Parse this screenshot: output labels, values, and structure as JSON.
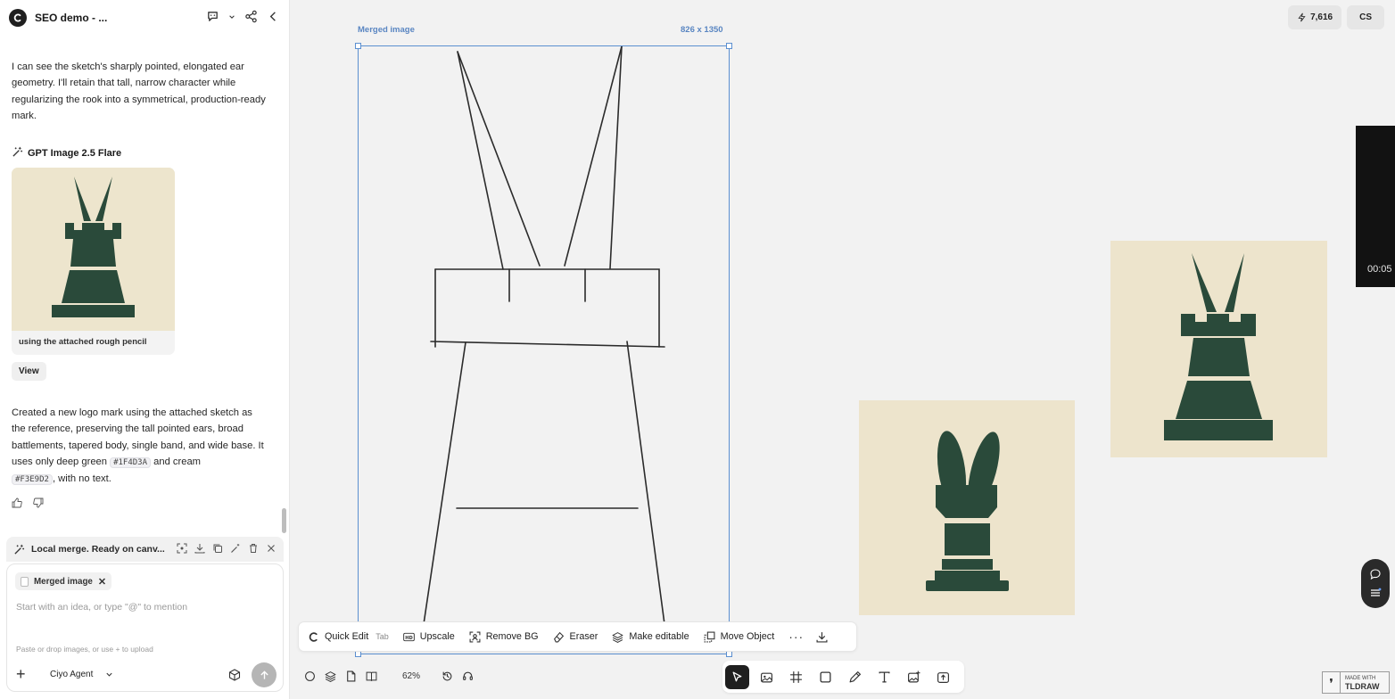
{
  "project": {
    "title": "SEO demo - ..."
  },
  "chat": {
    "message1": "I can see the sketch's sharply pointed, elongated ear geometry. I'll retain that tall, narrow character while regularizing the rook into a symmetrical, production-ready mark.",
    "model_name": "GPT Image 2.5 Flare",
    "thumb_caption": "using the attached rough pencil",
    "view_label": "View",
    "message2_a": "Created a new logo mark using the attached sketch as the reference, preserving the tall pointed ears, broad battlements, tapered body, single band, and wide base. It uses only deep green",
    "color1": "#1F4D3A",
    "message2_b": "and cream",
    "color2": "#F3E9D2",
    "message2_c": ", with no text."
  },
  "merge_status": {
    "label": "Local merge. Ready on canv..."
  },
  "composer": {
    "chip_label": "Merged image",
    "placeholder": "Start with an idea, or type \"@\" to mention",
    "hint": "Paste or drop images, or use + to upload",
    "agent_label": "Ciyo Agent"
  },
  "canvas": {
    "selection_label": "Merged image",
    "selection_size": "826 x 1350",
    "credits": "7,616",
    "user_initials": "CS",
    "video_time": "00:05",
    "zoom": "62%",
    "made_with_1": "MADE WITH",
    "made_with_2": "TLDRAW"
  },
  "toolbar": {
    "quick_edit": "Quick Edit",
    "quick_edit_kbd": "Tab",
    "upscale": "Upscale",
    "remove_bg": "Remove BG",
    "eraser": "Eraser",
    "make_editable": "Make editable",
    "move_object": "Move Object",
    "more": "···"
  },
  "colors": {
    "deep_green": "#1F4D3A",
    "cream": "#F3E9D2",
    "selection_blue": "#5B8FD0"
  },
  "icons": [
    "ciyo-logo-icon",
    "comment-icon",
    "share-icon",
    "collapse-icon",
    "magic-wand-icon",
    "thumbs-up-icon",
    "thumbs-down-icon",
    "bolt-icon",
    "select-tool-icon",
    "image-tool-icon",
    "frame-tool-icon",
    "rectangle-tool-icon",
    "pencil-tool-icon",
    "text-tool-icon",
    "add-image-icon",
    "export-icon",
    "download-icon"
  ]
}
